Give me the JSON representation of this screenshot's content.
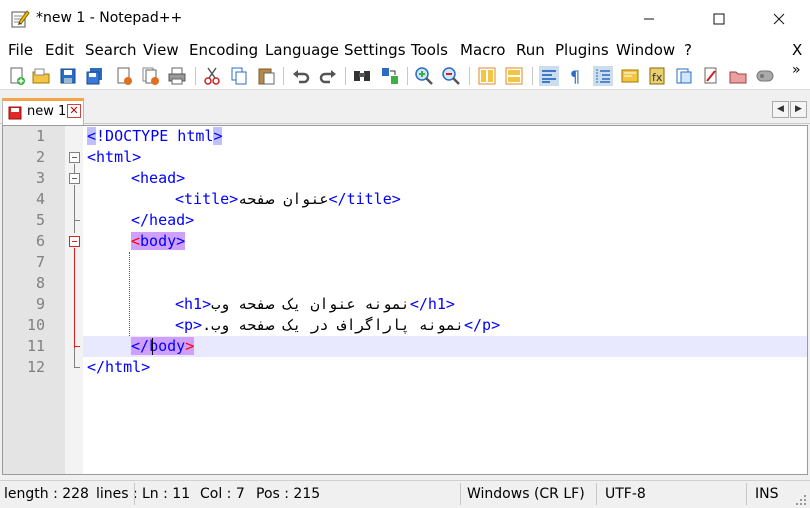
{
  "window": {
    "title": "*new 1 - Notepad++",
    "minimize_glyph": "—",
    "maximize_glyph": "☐",
    "close_glyph": "✕"
  },
  "menu": {
    "items": [
      {
        "label": "File"
      },
      {
        "label": "Edit"
      },
      {
        "label": "Search"
      },
      {
        "label": "View"
      },
      {
        "label": "Encoding"
      },
      {
        "label": "Language"
      },
      {
        "label": "Settings"
      },
      {
        "label": "Tools"
      },
      {
        "label": "Macro"
      },
      {
        "label": "Run"
      },
      {
        "label": "Plugins"
      },
      {
        "label": "Window"
      },
      {
        "label": "?"
      }
    ],
    "close_doc_glyph": "X"
  },
  "toolbar": {
    "icons": [
      "new-file-icon",
      "open-file-icon",
      "save-icon",
      "save-all-icon",
      "close-icon",
      "close-all-icon",
      "print-icon",
      "cut-icon",
      "copy-icon",
      "paste-icon",
      "undo-icon",
      "redo-icon",
      "find-icon",
      "replace-icon",
      "zoom-in-icon",
      "zoom-out-icon",
      "sync-vertical-icon",
      "sync-horizontal-icon",
      "word-wrap-icon",
      "show-all-chars-icon",
      "indent-guide-icon",
      "doc-map-icon",
      "function-list-icon",
      "folder-workspace-icon",
      "monitoring-icon",
      "record-macro-icon",
      "stop-record-icon"
    ],
    "overflow_glyph": "»"
  },
  "tabs": [
    {
      "label": "new 1",
      "close_glyph": "✕"
    }
  ],
  "tab_scroll": {
    "left": "◀",
    "right": "▶"
  },
  "editor": {
    "lines": [
      {
        "n": "1"
      },
      {
        "n": "2"
      },
      {
        "n": "3"
      },
      {
        "n": "4"
      },
      {
        "n": "5"
      },
      {
        "n": "6"
      },
      {
        "n": "7"
      },
      {
        "n": "8"
      },
      {
        "n": "9"
      },
      {
        "n": "10"
      },
      {
        "n": "11"
      },
      {
        "n": "12"
      }
    ],
    "code": {
      "l1_lt": "<",
      "l1_rest": "!DOCTYPE html",
      "l1_gt": ">",
      "l2": "<html>",
      "l3": "<head>",
      "l4_open": "<title>",
      "l4_text": "عنوان صفحه",
      "l4_close": "</title>",
      "l5": "</head>",
      "l6_lt": "<",
      "l6_name": "body",
      "l6_gt": ">",
      "l8_open": "<h1>",
      "l8_text": "نمونه عنوان یک صفحه وب",
      "l8_close": "</h1>",
      "l9_open": "<p>",
      "l9_text": "نمونه پاراگراف در یک صفحه وب.",
      "l9_close": "</p>",
      "l11_open": "</",
      "l11_name": "body",
      "l11_gt": ">",
      "l12": "</html>"
    }
  },
  "status": {
    "length": "length : 228",
    "lines": "lines :",
    "ln": "Ln : 11",
    "col": "Col : 7",
    "pos": "Pos : 215",
    "eol": "Windows (CR LF)",
    "encoding": "UTF-8",
    "mode": "INS"
  }
}
